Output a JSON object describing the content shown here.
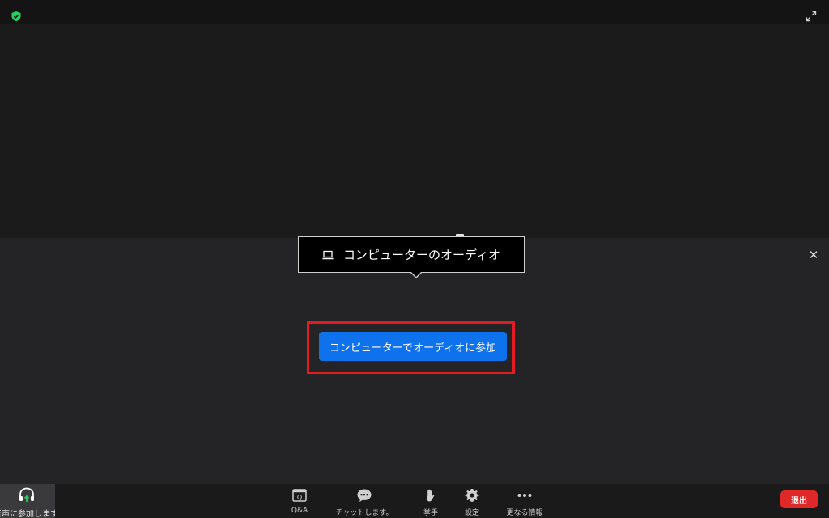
{
  "tooltip": {
    "text": "コンピューターのオーディオ"
  },
  "join_button": {
    "label": "コンピューターでオーディオに参加"
  },
  "toolbar": {
    "audio_join_label": "音声に参加します",
    "qa_label": "Q&A",
    "chat_label": "チャットします。",
    "raise_hand_label": "挙手",
    "settings_label": "設定",
    "more_label": "更なる情報",
    "leave_label": "退出"
  },
  "colors": {
    "accent_blue": "#0e72ed",
    "leave_red": "#e02828",
    "highlight_red": "#e11c24",
    "secure_green": "#23d160"
  }
}
